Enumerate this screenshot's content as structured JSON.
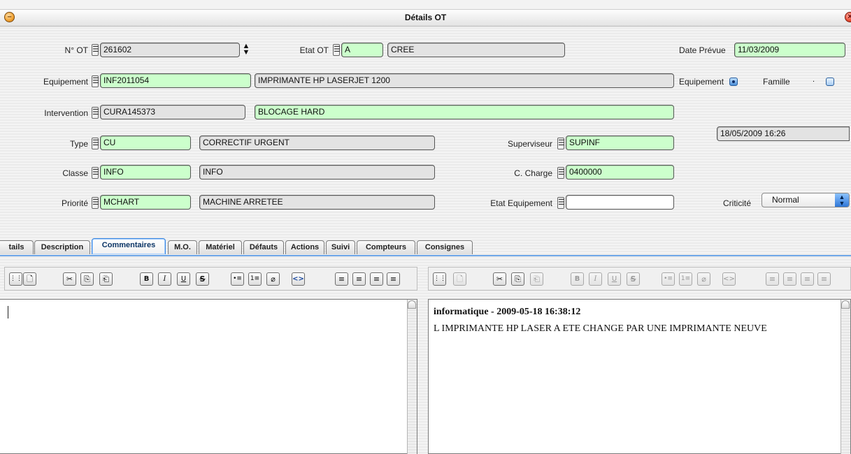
{
  "window": {
    "title": "Détails OT"
  },
  "form": {
    "no_ot": {
      "label": "N° OT",
      "value": "261602"
    },
    "etat_ot": {
      "label": "Etat OT",
      "code": "A",
      "text": "CREE"
    },
    "date_prevue": {
      "label": "Date Prévue",
      "value": "11/03/2009"
    },
    "equipement": {
      "label": "Equipement",
      "code": "INF2011054",
      "text": "IMPRIMANTE HP LASERJET 1200"
    },
    "radio_equipement": {
      "label": "Equipement",
      "selected": true
    },
    "radio_famille": {
      "label": "Famille",
      "selected": false
    },
    "intervention": {
      "label": "Intervention",
      "code": "CURA145373",
      "text": "BLOCAGE HARD"
    },
    "datetime": "18/05/2009 16:26",
    "type": {
      "label": "Type",
      "code": "CU",
      "text": "CORRECTIF URGENT"
    },
    "superviseur": {
      "label": "Superviseur",
      "code": "SUPINF"
    },
    "classe": {
      "label": "Classe",
      "code": "INFO",
      "text": "INFO"
    },
    "c_charge": {
      "label": "C. Charge",
      "code": "0400000"
    },
    "priorite": {
      "label": "Priorité",
      "code": "MCHART",
      "text": "MACHINE ARRETEE"
    },
    "etat_equipement": {
      "label": "Etat Equipement",
      "value": ""
    },
    "criticite": {
      "label": "Criticité",
      "value": "Normal"
    },
    "lookup_glyph": "☰",
    "spin_glyph": "▲▼"
  },
  "tabs": [
    {
      "label": "tails",
      "active": false
    },
    {
      "label": "Description",
      "active": false
    },
    {
      "label": "Commentaires",
      "active": true
    },
    {
      "label": "M.O.",
      "active": false
    },
    {
      "label": "Matériel",
      "active": false
    },
    {
      "label": "Défauts",
      "active": false
    },
    {
      "label": "Actions",
      "active": false
    },
    {
      "label": "Suivi",
      "active": false
    },
    {
      "label": "Compteurs",
      "active": false
    },
    {
      "label": "Consignes",
      "active": false
    }
  ],
  "toolbar": {
    "icons": [
      "source-view-icon",
      "new-doc-icon",
      "cut-icon",
      "copy-icon",
      "paste-icon",
      "bold-icon",
      "italic-icon",
      "underline-icon",
      "strikethrough-icon",
      "bullet-list-icon",
      "numbered-list-icon",
      "link-icon",
      "code-icon",
      "align-left-icon",
      "align-center-icon",
      "align-right-icon",
      "justify-icon"
    ],
    "glyphs": [
      "⋮⋮",
      "🗋",
      "✂",
      "⎘",
      "⎗",
      "B",
      "I",
      "U",
      "S",
      "•≡",
      "1≡",
      "⌀",
      "<>",
      "≡",
      "≡",
      "≡",
      "≡"
    ]
  },
  "comment_history": {
    "author_line": "informatique - 2009-05-18 16:38:12",
    "text": "L IMPRIMANTE HP LASER A ETE CHANGE PAR UNE IMPRIMANTE NEUVE"
  },
  "colors": {
    "required_field": "#ccffcc",
    "readonly_field": "#e3e3e3",
    "tab_accent": "#3b87e0"
  }
}
